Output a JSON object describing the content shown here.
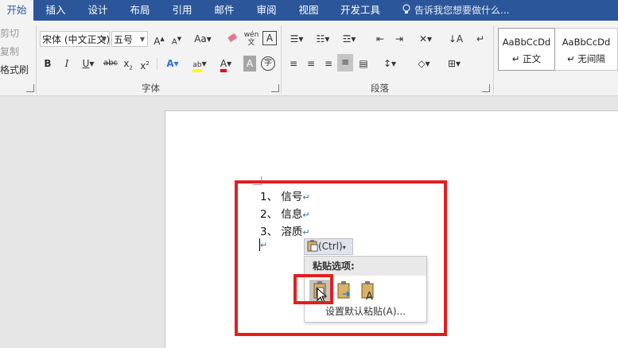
{
  "tabs": [
    {
      "label": "开始",
      "active": true
    },
    {
      "label": "插入"
    },
    {
      "label": "设计"
    },
    {
      "label": "布局"
    },
    {
      "label": "引用"
    },
    {
      "label": "邮件"
    },
    {
      "label": "审阅"
    },
    {
      "label": "视图"
    },
    {
      "label": "开发工具"
    }
  ],
  "tellme": "告诉我您想要做什么...",
  "clipboard": {
    "cut": "剪切",
    "copy": "复制",
    "format_painter": "格式刷"
  },
  "font": {
    "name": "宋体 (中文正文)",
    "size": "五号",
    "group_label": "字体"
  },
  "paragraph": {
    "group_label": "段落"
  },
  "styles": [
    {
      "preview": "AaBbCcDd",
      "name": "正文"
    },
    {
      "preview": "AaBbCcDd",
      "name": "无间隔"
    }
  ],
  "document": {
    "items": [
      "1、 信号",
      "2、 信息",
      "3、 溶质"
    ]
  },
  "paste_popup": {
    "button_label": "(Ctrl)",
    "menu_title": "粘贴选项:",
    "default_paste": "设置默认粘贴(A)..."
  },
  "colors": {
    "ribbon_blue": "#2b579a",
    "highlight_red": "#e02020"
  }
}
